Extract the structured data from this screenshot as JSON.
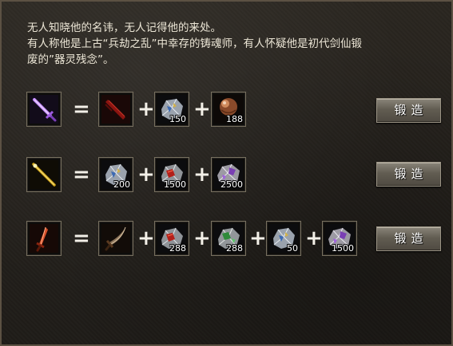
{
  "description": {
    "line1": "无人知晓他的名讳，无人记得他的来处。",
    "line2": "有人称他是上古“兵劫之乱”中幸存的铸魂师，有人怀疑他是初代剑仙锻",
    "line3": "废的”器灵残念”。"
  },
  "ui": {
    "equals": "=",
    "plus": "+"
  },
  "recipes": [
    {
      "result_icon": "purple-sword-icon",
      "ingredients": [
        {
          "icon": "red-blade-icon",
          "qty": ""
        },
        {
          "icon": "blue-ore-icon",
          "qty": "150"
        },
        {
          "icon": "copper-orb-icon",
          "qty": "188"
        }
      ],
      "button": "锻造"
    },
    {
      "result_icon": "golden-staff-icon",
      "ingredients": [
        {
          "icon": "blue-ore-icon",
          "qty": "200"
        },
        {
          "icon": "red-ore-icon",
          "qty": "1500"
        },
        {
          "icon": "purple-ore-icon",
          "qty": "2500"
        }
      ],
      "button": "锻造"
    },
    {
      "result_icon": "red-sword-icon",
      "ingredients": [
        {
          "icon": "curved-saber-icon",
          "qty": ""
        },
        {
          "icon": "red-ore-icon",
          "qty": "288"
        },
        {
          "icon": "green-ore-icon",
          "qty": "288"
        },
        {
          "icon": "blue-ore-icon",
          "qty": "50"
        },
        {
          "icon": "purple-ore-icon",
          "qty": "1500"
        }
      ],
      "button": "锻造"
    }
  ]
}
